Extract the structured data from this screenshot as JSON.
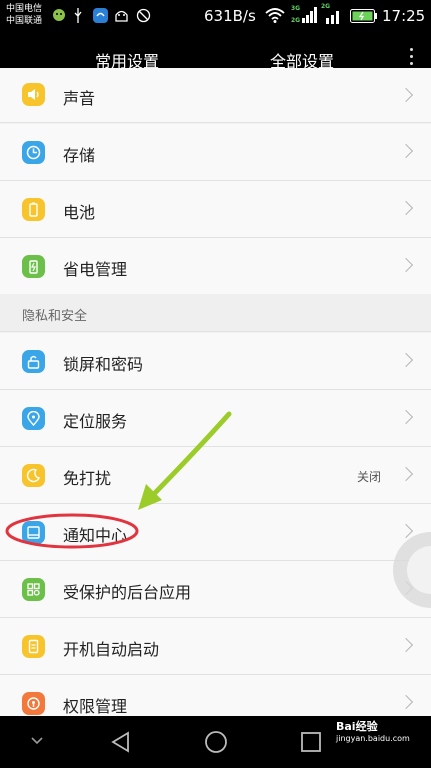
{
  "status_bar": {
    "carrier_1": "中国电信",
    "carrier_2": "中国联通",
    "speed": "631B/s",
    "net_1": "3G",
    "net_2": "2G",
    "net_3": "2G",
    "time": "17:25",
    "icons": [
      "wechat-icon",
      "usb-icon",
      "app-icon",
      "android-icon",
      "block-icon",
      "wifi-icon",
      "signal-icon",
      "battery-icon"
    ]
  },
  "tabs": [
    {
      "label": "常用设置",
      "active": false
    },
    {
      "label": "全部设置",
      "active": true
    }
  ],
  "rows_top": [
    {
      "label": "声音",
      "icon": "sound-icon",
      "color": "#f7c52b"
    },
    {
      "label": "存储",
      "icon": "storage-icon",
      "color": "#3aa6e8"
    },
    {
      "label": "电池",
      "icon": "battery-icon",
      "color": "#f7c52b"
    },
    {
      "label": "省电管理",
      "icon": "power-saving-icon",
      "color": "#6cc04a"
    }
  ],
  "section": {
    "label": "隐私和安全"
  },
  "rows_bottom": [
    {
      "label": "锁屏和密码",
      "icon": "lock-icon",
      "color": "#3aa6e8"
    },
    {
      "label": "定位服务",
      "icon": "location-icon",
      "color": "#3aa6e8"
    },
    {
      "label": "免打扰",
      "icon": "moon-icon",
      "color": "#f7c52b",
      "value": "关闭"
    },
    {
      "label": "通知中心",
      "icon": "notification-icon",
      "color": "#3aa6e8"
    },
    {
      "label": "受保护的后台应用",
      "icon": "protected-apps-icon",
      "color": "#6cc04a"
    },
    {
      "label": "开机自动启动",
      "icon": "auto-start-icon",
      "color": "#f7c52b"
    },
    {
      "label": "权限管理",
      "icon": "permission-icon",
      "color": "#f2783c"
    }
  ],
  "watermark": {
    "title": "Bai经验",
    "url": "jingyan.baidu.com"
  },
  "nav": [
    "back-icon",
    "home-icon",
    "recent-apps-icon",
    "collapse-icon"
  ]
}
